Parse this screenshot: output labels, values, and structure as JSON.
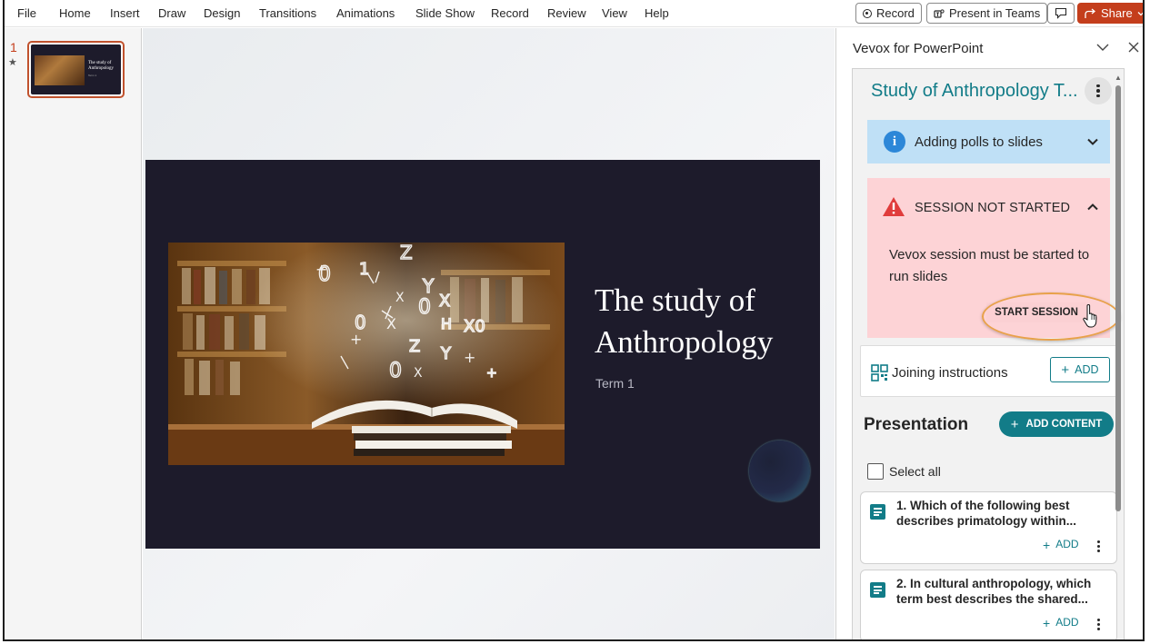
{
  "ribbon": {
    "menu": [
      "File",
      "Home",
      "Insert",
      "Draw",
      "Design",
      "Transitions",
      "Animations",
      "Slide Show",
      "Record",
      "Review",
      "View",
      "Help"
    ],
    "record_label": "Record",
    "present_teams_label": "Present in Teams",
    "share_label": "Share"
  },
  "thumbnail": {
    "number": "1",
    "marker": "★",
    "title": "The study of Anthropology",
    "subtitle": "Term 1"
  },
  "slide": {
    "title": "The study of Anthropology",
    "subtitle": "Term 1"
  },
  "panel": {
    "title": "Vevox for PowerPoint",
    "presentation_name": "Study of Anthropology T...",
    "info": {
      "text": "Adding polls to slides"
    },
    "warning": {
      "title": "SESSION NOT STARTED",
      "message": "Vevox session must be started to run slides",
      "start_label": "START SESSION"
    },
    "joining": {
      "label": "Joining instructions",
      "add_label": "ADD",
      "plus": "+"
    },
    "presentation_heading": "Presentation",
    "add_content_label": "ADD CONTENT",
    "select_all_label": "Select all",
    "polls": [
      {
        "text": "1. Which of the following best describes primatology within...",
        "add_label": "ADD"
      },
      {
        "text": "2. In cultural anthropology, which term best describes the shared...",
        "add_label": "ADD"
      }
    ]
  },
  "colors": {
    "accent_teal": "#127c88",
    "share_orange": "#c43e1c",
    "warning_bg": "#fdd3d6",
    "info_bg": "#bfe0f6",
    "slide_bg": "#1d1b2b"
  }
}
